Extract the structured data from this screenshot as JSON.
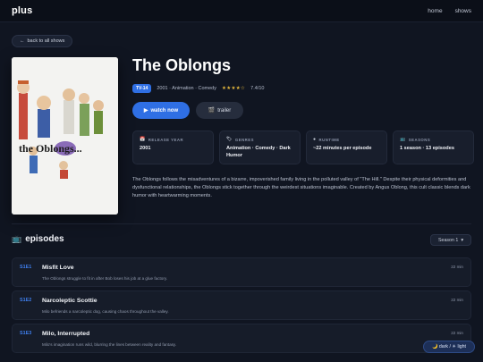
{
  "app": {
    "logo": "plus"
  },
  "nav": {
    "home": "home",
    "shows": "shows"
  },
  "back": {
    "label": "back to all shows"
  },
  "show": {
    "title": "The Oblongs",
    "rating_badge": "TV-14",
    "meta": "2001 · Animation · Comedy",
    "stars": "★★★★☆",
    "score": "7.4/10",
    "description": "The Oblongs follows the misadventures of a bizarre, impoverished family living in the polluted valley of \"The Hill.\" Despite their physical deformities and dysfunctional relationships, the Oblongs stick together through the weirdest situations imaginable. Created by Angus Oblong, this cult classic blends dark humor with heartwarming moments.",
    "poster_logo_text": "the Oblongs..."
  },
  "actions": {
    "watch": "watch now",
    "trailer": "trailer"
  },
  "info_cards": [
    {
      "icon": "calendar-icon",
      "label": "RELEASE YEAR",
      "value": "2001"
    },
    {
      "icon": "tag-icon",
      "label": "GENRES",
      "value": "Animation · Comedy · Dark Humor"
    },
    {
      "icon": "clock-icon",
      "label": "RUNTIME",
      "value": "~22 minutes per episode"
    },
    {
      "icon": "tv-icon",
      "label": "SEASONS",
      "value": "1 season · 13 episodes"
    }
  ],
  "episodes_section": {
    "title": "episodes",
    "season_select": "Season 1"
  },
  "episodes": [
    {
      "code": "S1E1",
      "title": "Misfit Love",
      "desc": "The Oblongs struggle to fit in after Bob loses his job at a glue factory.",
      "duration": "22 min"
    },
    {
      "code": "S1E2",
      "title": "Narcoleptic Scottie",
      "desc": "Milo befriends a narcoleptic dog, causing chaos throughout the valley.",
      "duration": "22 min"
    },
    {
      "code": "S1E3",
      "title": "Milo, Interrupted",
      "desc": "Milo's imagination runs wild, blurring the lines between reality and fantasy.",
      "duration": "22 min"
    }
  ],
  "theme": {
    "dark": "dark",
    "light": "light"
  },
  "colors": {
    "accent": "#2f6fe4",
    "background": "#101521",
    "card": "#181e2c",
    "star": "#e5b83c"
  }
}
